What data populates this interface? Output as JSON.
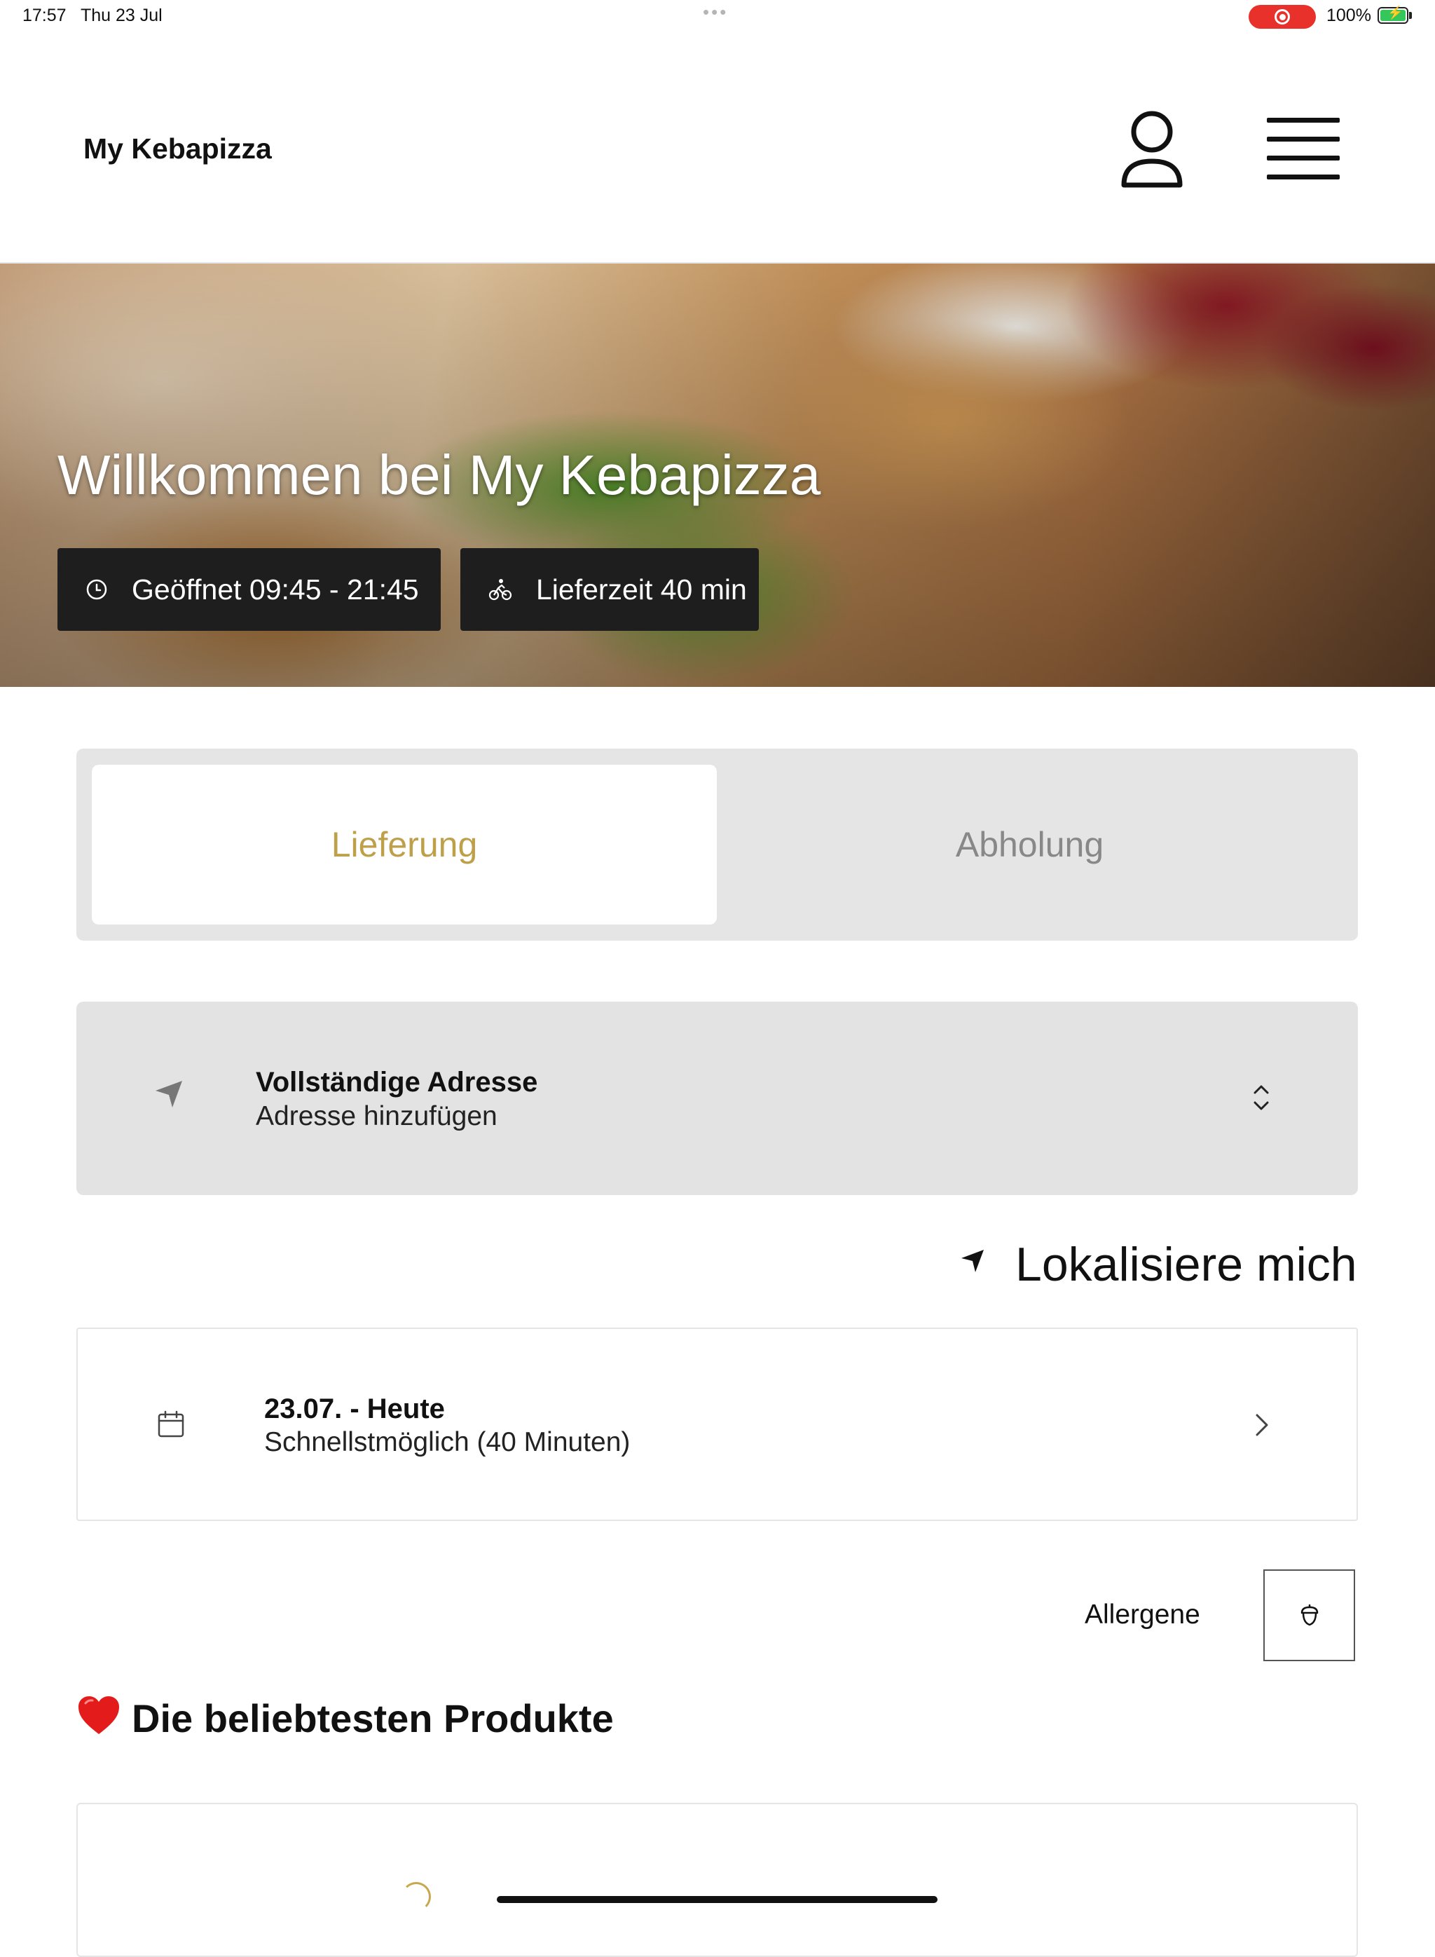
{
  "status_bar": {
    "time": "17:57",
    "date": "Thu 23 Jul",
    "dots": "•••",
    "battery_percent": "100%",
    "record_color": "#e8312a",
    "battery_color": "#35c759"
  },
  "header": {
    "brand": "My Kebapizza",
    "user_icon": "user-icon",
    "menu_icon": "hamburger-menu-icon"
  },
  "hero": {
    "title": "Willkommen bei My Kebapizza",
    "opening_hours": "Geöffnet 09:45 - 21:45",
    "delivery_time": "Lieferzeit 40 min",
    "clock_icon": "clock-icon",
    "bike_icon": "bicycle-icon"
  },
  "order_mode": {
    "options": [
      "Lieferung",
      "Abholung"
    ],
    "selected": "Lieferung",
    "active_color": "#bfa04a"
  },
  "address": {
    "title": "Vollständige Adresse",
    "subtitle": "Adresse hinzufügen",
    "icon": "location-arrow-icon",
    "chevron_icon": "chevron-up-down-icon"
  },
  "locate": {
    "label": "Lokalisiere mich",
    "icon": "location-arrow-icon"
  },
  "schedule": {
    "title": "23.07. - Heute",
    "subtitle": "Schnellstmöglich (40 Minuten)",
    "icon": "calendar-icon",
    "chevron_icon": "chevron-right-icon"
  },
  "allergens": {
    "label": "Allergene",
    "icon": "acorn-icon"
  },
  "popular": {
    "emoji": "❤️",
    "title": "Die beliebtesten Produkte"
  }
}
